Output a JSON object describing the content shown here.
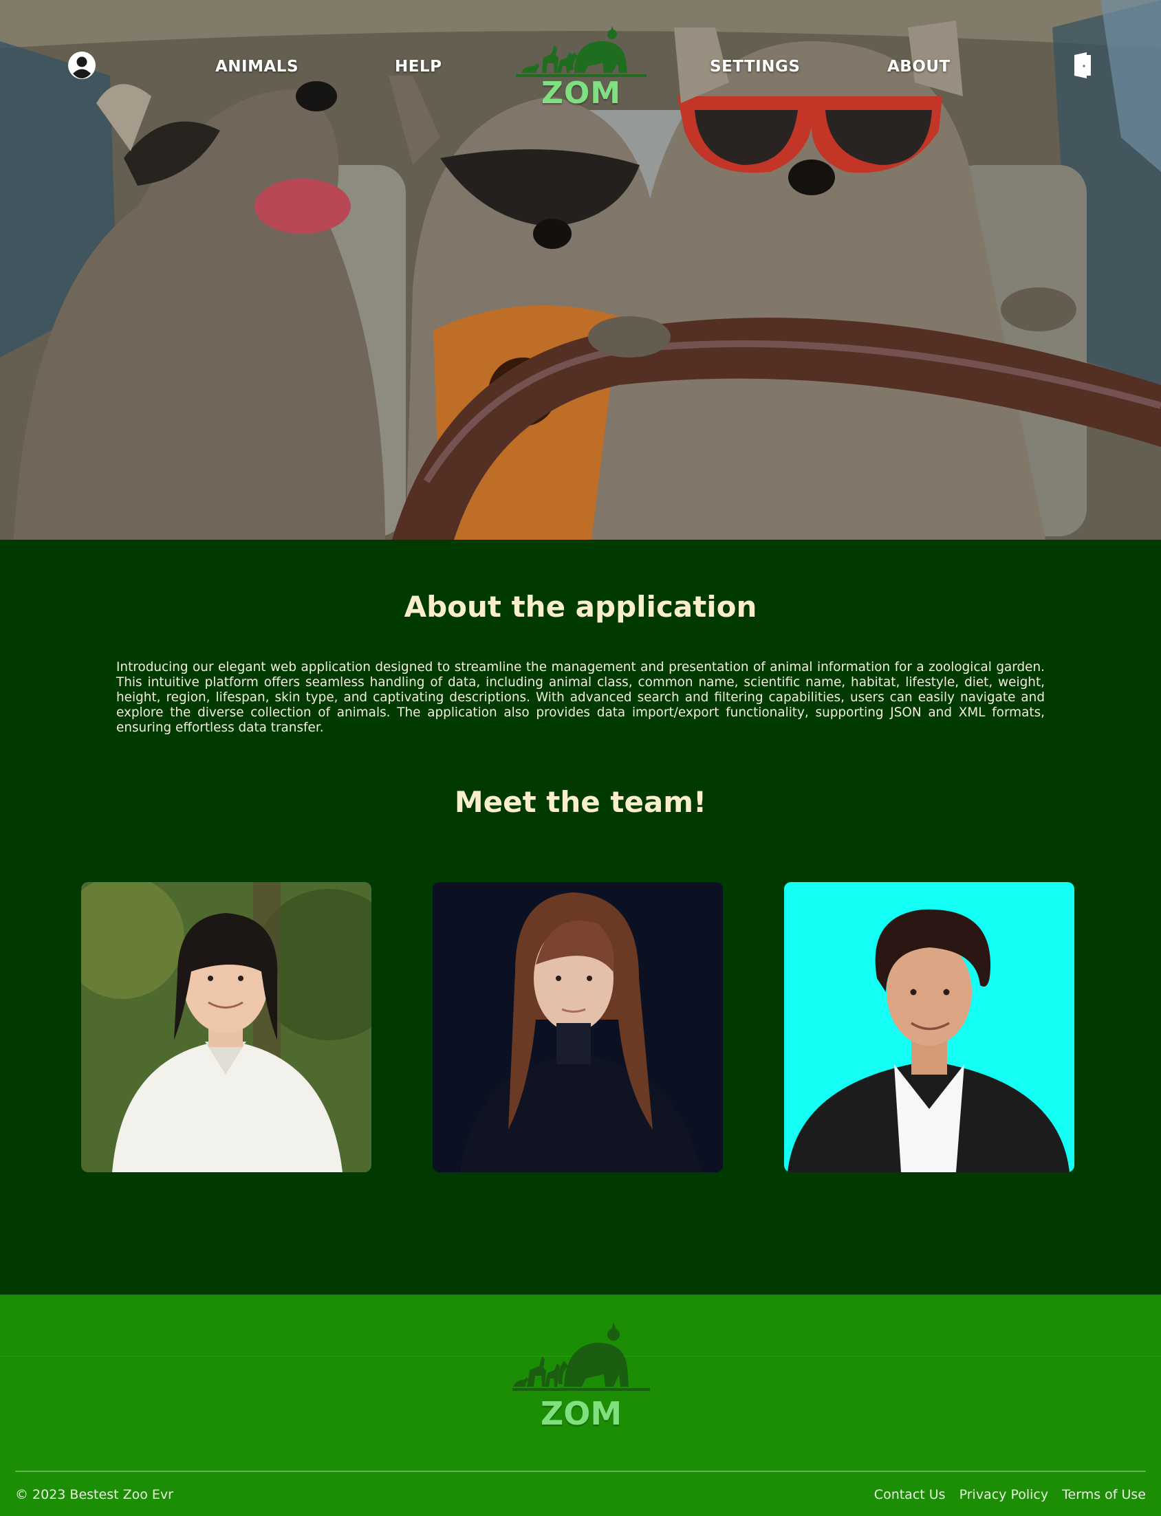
{
  "nav": {
    "user_icon": "user-circle-icon",
    "links": [
      "ANIMALS",
      "HELP",
      "SETTINGS",
      "ABOUT"
    ],
    "logo_text": "ZOM",
    "logout_icon": "door-exit-icon"
  },
  "hero": {
    "image": "raccoons-driving-car-photo"
  },
  "about": {
    "title": "About the application",
    "text": "Introducing our elegant web application designed to streamline the management and presentation of animal information for a zoological garden. This intuitive platform offers seamless handling of data, including animal class, common name, scientific name, habitat, lifestyle, diet, weight, height, region, lifespan, skin type, and captivating descriptions. With advanced search and filtering capabilities, users can easily navigate and explore the diverse collection of animals. The application also provides data import/export functionality, supporting JSON and XML formats, ensuring effortless data transfer."
  },
  "team": {
    "title": "Meet the team!",
    "members": [
      {
        "photo": "team-member-1-photo",
        "background": "#4e6a2e"
      },
      {
        "photo": "team-member-2-photo",
        "background": "#0b1122"
      },
      {
        "photo": "team-member-3-photo",
        "background": "#13fff6"
      }
    ]
  },
  "footer": {
    "logo_text": "ZOM",
    "copyright": "© 2023 Bestest Zoo Evr",
    "links": [
      "Contact Us",
      "Privacy Policy",
      "Terms of Use"
    ]
  },
  "colors": {
    "main_background": "#003a00",
    "footer_background": "#1c8e06",
    "heading": "#fbeecf",
    "logo_green": "#7ee081"
  }
}
